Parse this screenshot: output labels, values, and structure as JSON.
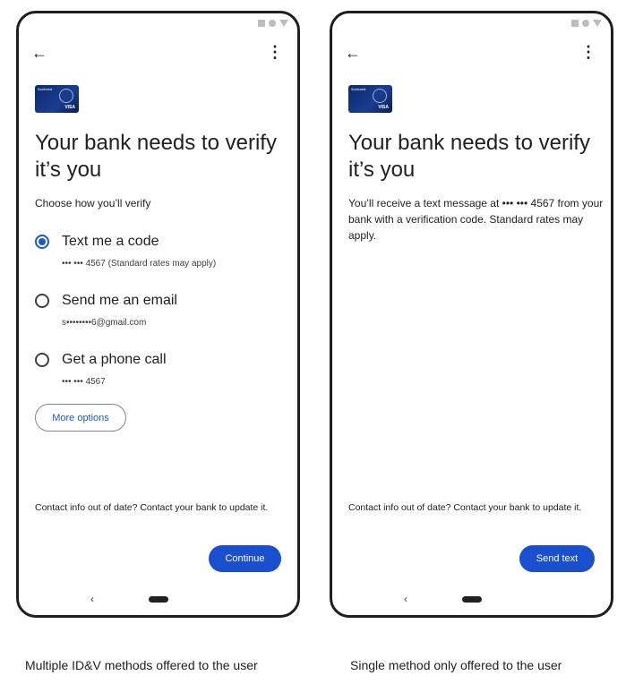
{
  "left": {
    "title": "Your bank needs to verify it’s you",
    "subtitle": "Choose how you’ll verify",
    "options": [
      {
        "label": "Text me a code",
        "detail": "••• ••• 4567 (Standard rates may apply)",
        "selected": true
      },
      {
        "label": "Send me an email",
        "detail": "s••••••••6@gmail.com",
        "selected": false
      },
      {
        "label": "Get a phone call",
        "detail": "••• ••• 4567",
        "selected": false
      }
    ],
    "more_options": "More options",
    "contact": "Contact info out of date? Contact your bank to update it.",
    "primary": "Continue",
    "caption": "Multiple ID&V methods offered to the user"
  },
  "right": {
    "title": "Your bank needs to verify it’s you",
    "body": "You’ll receive a text message at ••• ••• 4567 from your bank with a verification code. Standard rates may apply.",
    "contact": "Contact info out of date? Contact your bank to update it.",
    "primary": "Send text",
    "caption": "Single method only offered to the user"
  },
  "icons": {
    "back": "←",
    "more": "⋮",
    "nav_back": "‹"
  },
  "card": {
    "brand": "VISA",
    "bank": "Southwest"
  },
  "colors": {
    "accent": "#1a4fd0",
    "frame": "#1f1f1f"
  }
}
